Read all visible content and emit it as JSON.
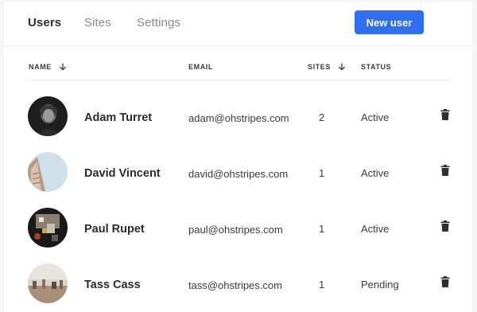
{
  "tabs": [
    {
      "label": "Users",
      "active": true
    },
    {
      "label": "Sites",
      "active": false
    },
    {
      "label": "Settings",
      "active": false
    }
  ],
  "new_user_button": "New user",
  "accent_color": "#2f6ff0",
  "table": {
    "columns": {
      "name": "NAME",
      "email": "EMAIL",
      "sites": "SITES",
      "status": "STATUS"
    },
    "sort_icon": "arrow-down-icon",
    "delete_icon": "trash-icon",
    "rows": [
      {
        "name": "Adam Turret",
        "email": "adam@ohstripes.com",
        "sites": "2",
        "status": "Active"
      },
      {
        "name": "David Vincent",
        "email": "david@ohstripes.com",
        "sites": "1",
        "status": "Active"
      },
      {
        "name": "Paul Rupet",
        "email": "paul@ohstripes.com",
        "sites": "1",
        "status": "Active"
      },
      {
        "name": "Tass Cass",
        "email": "tass@ohstripes.com",
        "sites": "1",
        "status": "Pending"
      }
    ]
  }
}
